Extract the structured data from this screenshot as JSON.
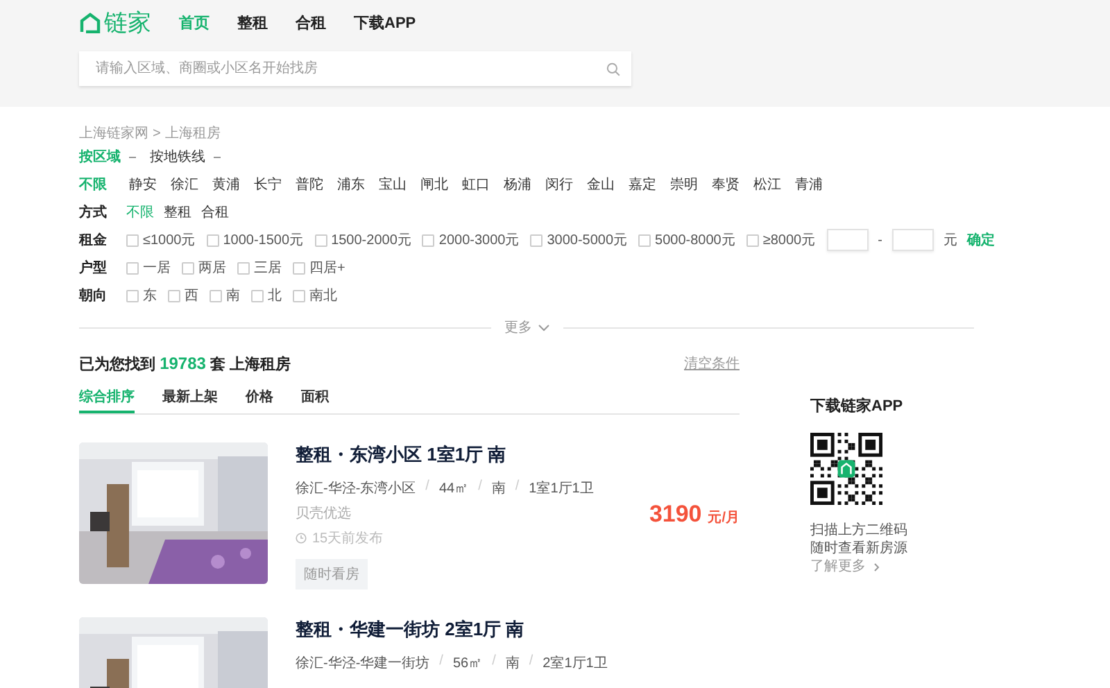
{
  "header": {
    "logo": "链家",
    "nav": [
      {
        "label": "首页",
        "selected": true
      },
      {
        "label": "整租",
        "selected": false
      },
      {
        "label": "合租",
        "selected": false
      },
      {
        "label": "下载APP",
        "selected": false
      }
    ],
    "search": {
      "placeholder": "请输入区域、商圈或小区名开始找房"
    }
  },
  "breadcrumb": {
    "items": [
      "上海链家网",
      "上海租房"
    ],
    "separator": ">"
  },
  "area_tabs": [
    {
      "label": "按区域",
      "selected": true
    },
    {
      "label": "按地铁线",
      "selected": false
    }
  ],
  "districts": [
    {
      "label": "不限",
      "selected": true
    },
    {
      "label": "静安",
      "selected": false
    },
    {
      "label": "徐汇",
      "selected": false
    },
    {
      "label": "黄浦",
      "selected": false
    },
    {
      "label": "长宁",
      "selected": false
    },
    {
      "label": "普陀",
      "selected": false
    },
    {
      "label": "浦东",
      "selected": false
    },
    {
      "label": "宝山",
      "selected": false
    },
    {
      "label": "闸北",
      "selected": false
    },
    {
      "label": "虹口",
      "selected": false
    },
    {
      "label": "杨浦",
      "selected": false
    },
    {
      "label": "闵行",
      "selected": false
    },
    {
      "label": "金山",
      "selected": false
    },
    {
      "label": "嘉定",
      "selected": false
    },
    {
      "label": "崇明",
      "selected": false
    },
    {
      "label": "奉贤",
      "selected": false
    },
    {
      "label": "松江",
      "selected": false
    },
    {
      "label": "青浦",
      "selected": false
    }
  ],
  "filter_rows": [
    {
      "kind": "tags",
      "label": "方式",
      "options": [
        {
          "label": "不限",
          "selected": true
        },
        {
          "label": "整租",
          "selected": false
        },
        {
          "label": "合租",
          "selected": false
        }
      ]
    },
    {
      "kind": "checks",
      "label": "租金",
      "options": [
        {
          "label": "≤1000元",
          "checked": false
        },
        {
          "label": "1000-1500元",
          "checked": false
        },
        {
          "label": "1500-2000元",
          "checked": false
        },
        {
          "label": "2000-3000元",
          "checked": false
        },
        {
          "label": "3000-5000元",
          "checked": false
        },
        {
          "label": "5000-8000元",
          "checked": false
        },
        {
          "label": "≥8000元",
          "checked": false
        }
      ],
      "range": {
        "separator": "-",
        "unit": "元",
        "confirm": "确定"
      }
    },
    {
      "kind": "checks",
      "label": "户型",
      "options": [
        {
          "label": "一居",
          "checked": false
        },
        {
          "label": "两居",
          "checked": false
        },
        {
          "label": "三居",
          "checked": false
        },
        {
          "label": "四居+",
          "checked": false
        }
      ]
    },
    {
      "kind": "checks",
      "label": "朝向",
      "options": [
        {
          "label": "东",
          "checked": false
        },
        {
          "label": "西",
          "checked": false
        },
        {
          "label": "南",
          "checked": false
        },
        {
          "label": "北",
          "checked": false
        },
        {
          "label": "南北",
          "checked": false
        }
      ]
    }
  ],
  "more": "更多",
  "results": {
    "prefix": "已为您找到",
    "count": "19783",
    "suffix": "套 上海租房",
    "clear": "清空条件"
  },
  "sort_tabs": [
    {
      "label": "综合排序",
      "selected": true
    },
    {
      "label": "最新上架",
      "selected": false
    },
    {
      "label": "价格",
      "selected": false
    },
    {
      "label": "面积",
      "selected": false
    }
  ],
  "listings": [
    {
      "title": "整租・东湾小区 1室1厅 南",
      "separator": "/",
      "details": [
        "徐汇-华泾-东湾小区",
        "44㎡",
        "南",
        "1室1厅1卫"
      ],
      "tag": "贝壳优选",
      "time": "15天前发布",
      "button": "随时看房",
      "price": "3190",
      "unit": "元/月"
    },
    {
      "title": "整租・华建一街坊 2室1厅 南",
      "separator": "/",
      "details": [
        "徐汇-华泾-华建一街坊",
        "56㎡",
        "南",
        "2室1厅1卫"
      ]
    }
  ],
  "sidebar": {
    "title": "下载链家APP",
    "lines": [
      "扫描上方二维码",
      "随时查看新房源"
    ],
    "link": "了解更多"
  }
}
